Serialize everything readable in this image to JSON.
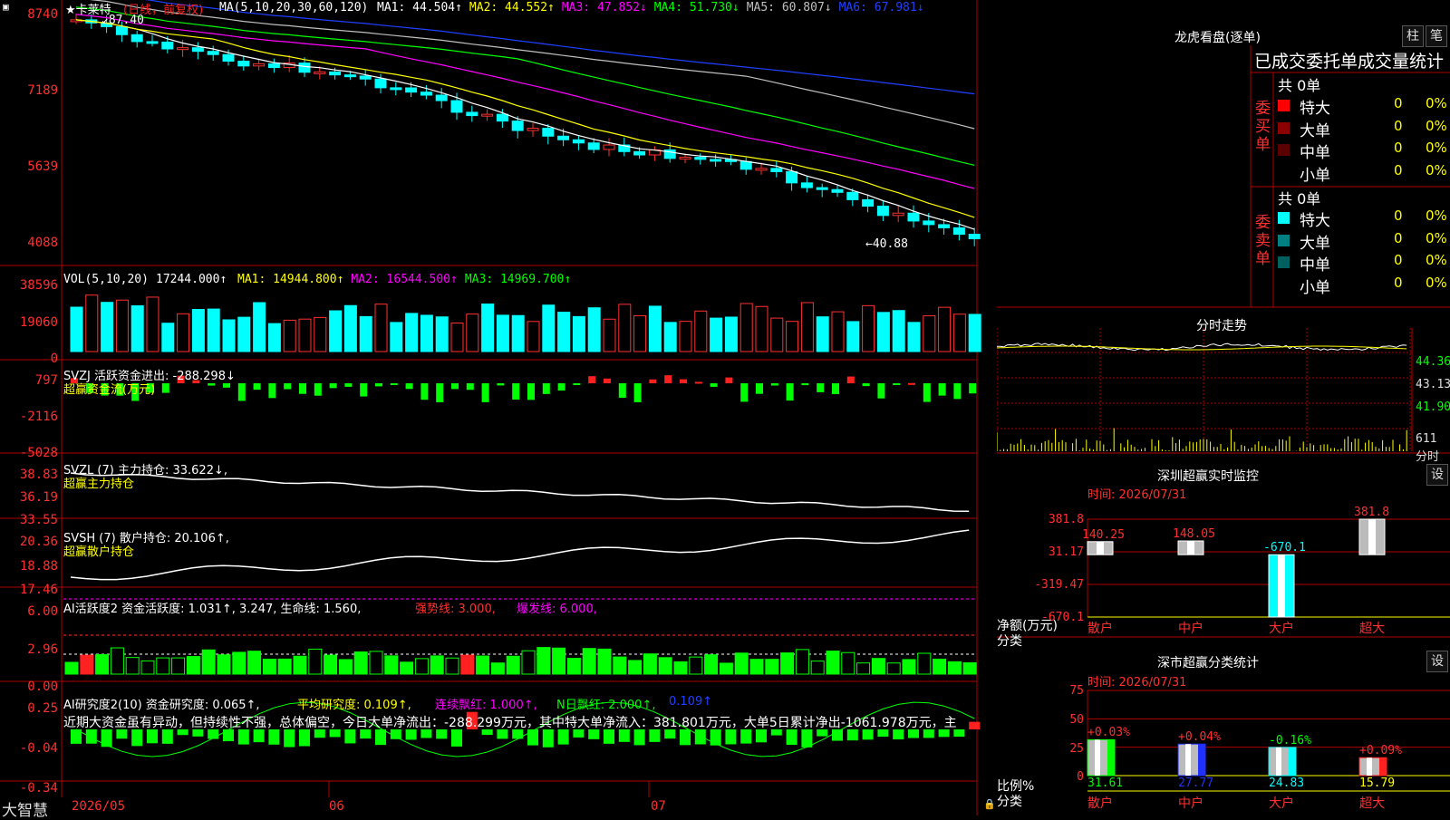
{
  "header": {
    "stock_title": "★卡莱特",
    "period": "(日线，前复权)",
    "ma_label": "MA(5,10,20,30,60,120)",
    "ma_values": [
      {
        "text": "MA1: 44.504↑",
        "color": "#ffffff"
      },
      {
        "text": "MA2: 44.552↑",
        "color": "#ffff00"
      },
      {
        "text": "MA3: 47.852↓",
        "color": "#ff00ff"
      },
      {
        "text": "MA4: 51.730↓",
        "color": "#00ff00"
      },
      {
        "text": "MA5: 60.807↓",
        "color": "#c0c0c0"
      },
      {
        "text": "MA6: 67.981↓",
        "color": "#2040ff"
      }
    ],
    "high_mark": "87.40",
    "low_mark": "←40.88"
  },
  "price_axis": [
    "8740",
    "7189",
    "5639",
    "4088"
  ],
  "volume": {
    "title": "VOL(5,10,20)",
    "value": "17244.000↑",
    "ma": [
      {
        "text": "MA1: 14944.800↑",
        "color": "#ffff00"
      },
      {
        "text": "MA2: 16544.500↑",
        "color": "#ff00ff"
      },
      {
        "text": "MA3: 14969.700↑",
        "color": "#00ff00"
      }
    ],
    "axis": [
      "38596",
      "19060",
      "0"
    ]
  },
  "svzj": {
    "title": "SVZJ  活跃资金进出: -288.298↓",
    "sub": "超赢资金流(万元)",
    "axis": [
      "797",
      "-2116",
      "-5028"
    ]
  },
  "svzl": {
    "title": "SVZL (7) 主力持仓: 33.622↓,",
    "sub": "超赢主力持仓",
    "axis": [
      "38.83",
      "36.19",
      "33.55"
    ]
  },
  "svsh": {
    "title": "SVSH (7) 散户持仓: 20.106↑,",
    "sub": "超赢散户持仓",
    "axis": [
      "20.36",
      "18.88",
      "17.46"
    ]
  },
  "ai_active": {
    "title_a": "AI活跃度2 资金活跃度: 1.031↑, 3.247, 生命线: 1.560,",
    "title_b": "强势线: 3.000,",
    "title_c": "爆发线: 6.000,",
    "axis": [
      "6.00",
      "2.96",
      "0.00"
    ]
  },
  "ai_research": {
    "title_a": "AI研究度2(10) 资金研究度: 0.065↑,",
    "title_b": "平均研究度: 0.109↑,",
    "title_c": "连续飘红: 1.000↑,",
    "title_d": "N日飘红: 2.000↑,",
    "title_e": "0.109↑",
    "comment": "近期大资金虽有异动，但持续性不强，总体偏空，今日大单净流出：-288.299万元，其中特大单净流入：381.801万元，大单5日累计净出-1061.978万元，主",
    "axis": [
      "0.25",
      "-0.04",
      "-0.34"
    ]
  },
  "date_axis": [
    "2026/05",
    "06",
    "07"
  ],
  "brand": "大智慧",
  "lhb": {
    "title": "龙虎看盘(逐单)",
    "btn_bar": "柱",
    "btn_pen": "笔",
    "subtitle": "已成交委托单成交量统计",
    "buy_label": "委买单",
    "sell_label": "委卖单",
    "buy_total": "共 0单",
    "sell_total": "共 0单",
    "buy_rows": [
      {
        "name": "特大",
        "count": "0",
        "pct": "0%",
        "color": "#ff0000"
      },
      {
        "name": "大单",
        "count": "0",
        "pct": "0%",
        "color": "#8b0000"
      },
      {
        "name": "中单",
        "count": "0",
        "pct": "0%",
        "color": "#5a0000"
      },
      {
        "name": "小单",
        "count": "0",
        "pct": "0%",
        "color": ""
      }
    ],
    "sell_rows": [
      {
        "name": "特大",
        "count": "0",
        "pct": "0%",
        "color": "#00ffff"
      },
      {
        "name": "大单",
        "count": "0",
        "pct": "0%",
        "color": "#008080"
      },
      {
        "name": "中单",
        "count": "0",
        "pct": "0%",
        "color": "#006060"
      },
      {
        "name": "小单",
        "count": "0",
        "pct": "0%",
        "color": ""
      }
    ]
  },
  "intraday": {
    "title": "分时走势",
    "axis": [
      "44.36",
      "43.13",
      "41.90"
    ],
    "vol_label": "611",
    "vol_sub": "分时"
  },
  "sz_monitor": {
    "title": "深圳超赢实时监控",
    "settings": "设",
    "time": "时间: 2026/07/31",
    "axis": [
      "381.8",
      "31.17",
      "-319.47",
      "-670.1"
    ],
    "ylabel": "净额(万元)",
    "xlabel": "分类",
    "categories": [
      "散户",
      "中户",
      "大户",
      "超大"
    ],
    "values": [
      140.25,
      148.05,
      -670.1,
      381.8
    ],
    "value_labels": [
      "140.25",
      "148.05",
      "-670.1",
      "381.8"
    ]
  },
  "sz_class": {
    "title": "深市超赢分类统计",
    "settings": "设",
    "time": "时间: 2026/07/31",
    "axis": [
      "75",
      "50",
      "25",
      "0"
    ],
    "ylabel": "比例%",
    "xlabel": "分类",
    "categories": [
      "散户",
      "中户",
      "大户",
      "超大"
    ],
    "values": [
      31.61,
      27.77,
      24.83,
      15.79
    ],
    "value_labels": [
      "31.61",
      "27.77",
      "24.83",
      "15.79"
    ],
    "changes": [
      "+0.03%",
      "+0.04%",
      "-0.16%",
      "+0.09%"
    ],
    "colors": [
      "#00ff00",
      "#2030ff",
      "#00ffff",
      "#ff2020"
    ]
  },
  "chart_data": {
    "type": "bar",
    "title": "深圳超赢实时监控",
    "categories": [
      "散户",
      "中户",
      "大户",
      "超大"
    ],
    "values": [
      140.25,
      148.05,
      -670.1,
      381.8
    ],
    "ylabel": "净额(万元)",
    "ylim": [
      -670.1,
      381.8
    ]
  }
}
